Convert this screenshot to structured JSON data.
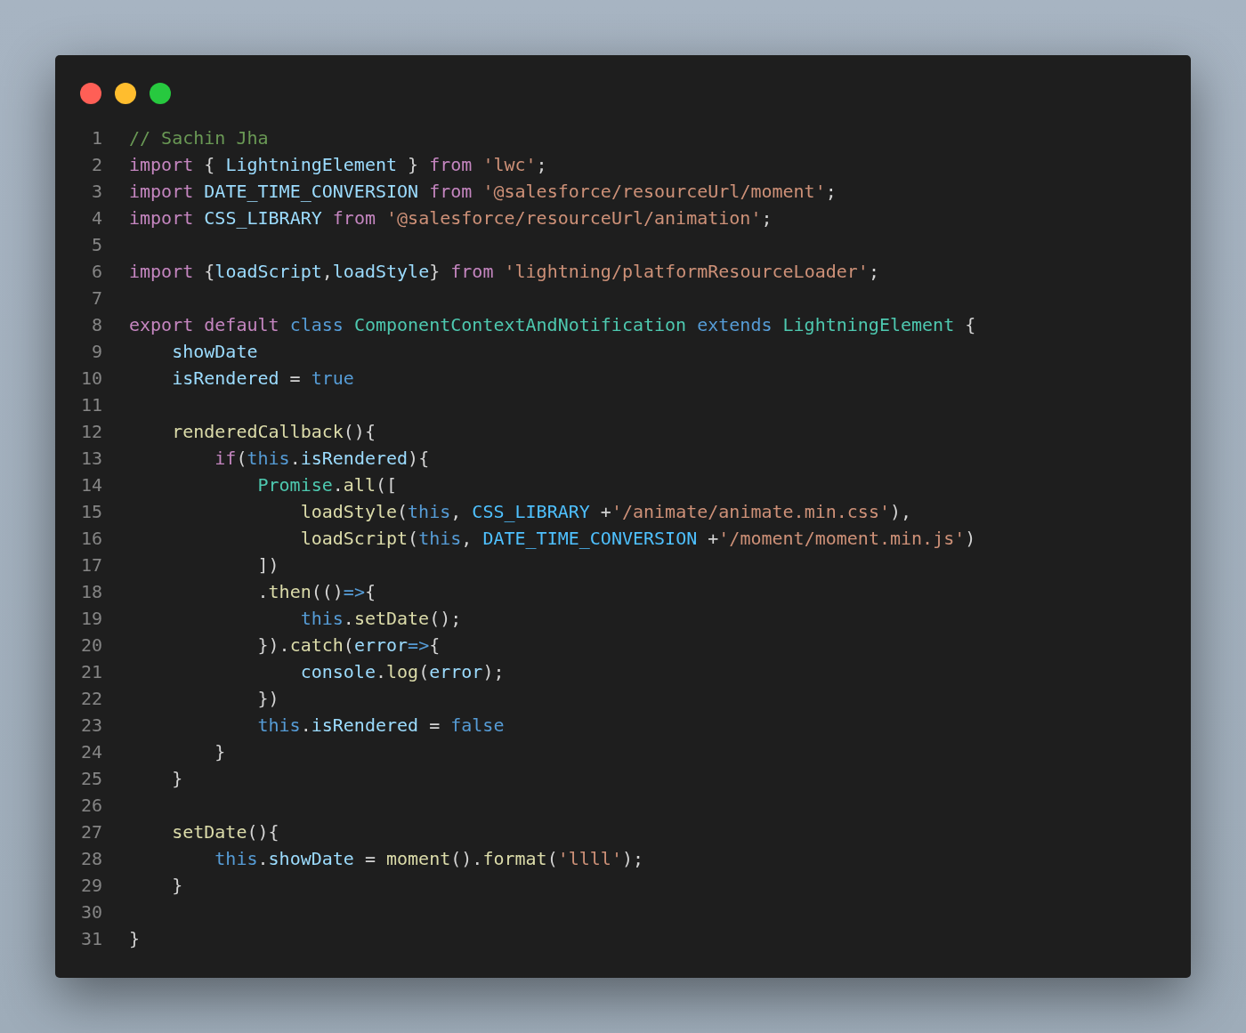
{
  "lines": [
    {
      "number": "1",
      "tokens": [
        {
          "kind": "comment",
          "text": "// Sachin Jha"
        }
      ]
    },
    {
      "number": "2",
      "tokens": [
        {
          "kind": "keyword",
          "text": "import"
        },
        {
          "kind": "plain",
          "text": " { "
        },
        {
          "kind": "variable",
          "text": "LightningElement"
        },
        {
          "kind": "plain",
          "text": " } "
        },
        {
          "kind": "keyword",
          "text": "from "
        },
        {
          "kind": "string",
          "text": "'lwc'"
        },
        {
          "kind": "plain",
          "text": ";"
        }
      ]
    },
    {
      "number": "3",
      "tokens": [
        {
          "kind": "keyword",
          "text": "import "
        },
        {
          "kind": "variable",
          "text": "DATE_TIME_CONVERSION "
        },
        {
          "kind": "keyword",
          "text": "from "
        },
        {
          "kind": "string",
          "text": "'@salesforce/resourceUrl/moment'"
        },
        {
          "kind": "plain",
          "text": ";"
        }
      ]
    },
    {
      "number": "4",
      "tokens": [
        {
          "kind": "keyword",
          "text": "import "
        },
        {
          "kind": "variable",
          "text": "CSS_LIBRARY "
        },
        {
          "kind": "keyword",
          "text": "from "
        },
        {
          "kind": "string",
          "text": "'@salesforce/resourceUrl/animation'"
        },
        {
          "kind": "plain",
          "text": ";"
        }
      ]
    },
    {
      "number": "5"
    },
    {
      "number": "6",
      "tokens": [
        {
          "kind": "keyword",
          "text": "import"
        },
        {
          "kind": "plain",
          "text": " {"
        },
        {
          "kind": "variable",
          "text": "loadScript"
        },
        {
          "kind": "plain",
          "text": ","
        },
        {
          "kind": "variable",
          "text": "loadStyle"
        },
        {
          "kind": "plain",
          "text": "} "
        },
        {
          "kind": "keyword",
          "text": "from "
        },
        {
          "kind": "string",
          "text": "'lightning/platformResourceLoader'"
        },
        {
          "kind": "plain",
          "text": ";"
        }
      ]
    },
    {
      "number": "7"
    },
    {
      "number": "8",
      "tokens": [
        {
          "kind": "keyword",
          "text": "export default "
        },
        {
          "kind": "storage",
          "text": "class "
        },
        {
          "kind": "class",
          "text": "ComponentContextAndNotification "
        },
        {
          "kind": "storage",
          "text": "extends "
        },
        {
          "kind": "class",
          "text": "LightningElement"
        },
        {
          "kind": "plain",
          "text": " {"
        }
      ]
    },
    {
      "number": "9",
      "tokens": [
        {
          "kind": "variable",
          "text": "    showDate"
        }
      ]
    },
    {
      "number": "10",
      "tokens": [
        {
          "kind": "variable",
          "text": "    isRendered"
        },
        {
          "kind": "plain",
          "text": " = "
        },
        {
          "kind": "storage",
          "text": "true"
        }
      ]
    },
    {
      "number": "11"
    },
    {
      "number": "12",
      "tokens": [
        {
          "kind": "function",
          "text": "    renderedCallback"
        },
        {
          "kind": "plain",
          "text": "(){"
        }
      ]
    },
    {
      "number": "13",
      "tokens": [
        {
          "kind": "keyword",
          "text": "        if"
        },
        {
          "kind": "plain",
          "text": "("
        },
        {
          "kind": "storage",
          "text": "this"
        },
        {
          "kind": "plain",
          "text": "."
        },
        {
          "kind": "variable",
          "text": "isRendered"
        },
        {
          "kind": "plain",
          "text": "){"
        }
      ]
    },
    {
      "number": "14",
      "tokens": [
        {
          "kind": "class",
          "text": "            Promise"
        },
        {
          "kind": "plain",
          "text": "."
        },
        {
          "kind": "function",
          "text": "all"
        },
        {
          "kind": "plain",
          "text": "(["
        }
      ]
    },
    {
      "number": "15",
      "tokens": [
        {
          "kind": "function",
          "text": "                loadStyle"
        },
        {
          "kind": "plain",
          "text": "("
        },
        {
          "kind": "storage",
          "text": "this"
        },
        {
          "kind": "plain",
          "text": ", "
        },
        {
          "kind": "constant",
          "text": "CSS_LIBRARY"
        },
        {
          "kind": "plain",
          "text": " +"
        },
        {
          "kind": "string",
          "text": "'/animate/animate.min.css'"
        },
        {
          "kind": "plain",
          "text": "),"
        }
      ]
    },
    {
      "number": "16",
      "tokens": [
        {
          "kind": "function",
          "text": "                loadScript"
        },
        {
          "kind": "plain",
          "text": "("
        },
        {
          "kind": "storage",
          "text": "this"
        },
        {
          "kind": "plain",
          "text": ", "
        },
        {
          "kind": "constant",
          "text": "DATE_TIME_CONVERSION"
        },
        {
          "kind": "plain",
          "text": " +"
        },
        {
          "kind": "string",
          "text": "'/moment/moment.min.js'"
        },
        {
          "kind": "plain",
          "text": ")"
        }
      ]
    },
    {
      "number": "17",
      "tokens": [
        {
          "kind": "plain",
          "text": "            ])"
        }
      ]
    },
    {
      "number": "18",
      "tokens": [
        {
          "kind": "plain",
          "text": "            ."
        },
        {
          "kind": "function",
          "text": "then"
        },
        {
          "kind": "plain",
          "text": "(()"
        },
        {
          "kind": "storage",
          "text": "=>"
        },
        {
          "kind": "plain",
          "text": "{"
        }
      ]
    },
    {
      "number": "19",
      "tokens": [
        {
          "kind": "storage",
          "text": "                this"
        },
        {
          "kind": "plain",
          "text": "."
        },
        {
          "kind": "function",
          "text": "setDate"
        },
        {
          "kind": "plain",
          "text": "();"
        }
      ]
    },
    {
      "number": "20",
      "tokens": [
        {
          "kind": "plain",
          "text": "            })."
        },
        {
          "kind": "function",
          "text": "catch"
        },
        {
          "kind": "plain",
          "text": "("
        },
        {
          "kind": "variable",
          "text": "error"
        },
        {
          "kind": "storage",
          "text": "=>"
        },
        {
          "kind": "plain",
          "text": "{"
        }
      ]
    },
    {
      "number": "21",
      "tokens": [
        {
          "kind": "variable",
          "text": "                console"
        },
        {
          "kind": "plain",
          "text": "."
        },
        {
          "kind": "function",
          "text": "log"
        },
        {
          "kind": "plain",
          "text": "("
        },
        {
          "kind": "variable",
          "text": "error"
        },
        {
          "kind": "plain",
          "text": ");"
        }
      ]
    },
    {
      "number": "22",
      "tokens": [
        {
          "kind": "plain",
          "text": "            })"
        }
      ]
    },
    {
      "number": "23",
      "tokens": [
        {
          "kind": "storage",
          "text": "            this"
        },
        {
          "kind": "plain",
          "text": "."
        },
        {
          "kind": "variable",
          "text": "isRendered"
        },
        {
          "kind": "plain",
          "text": " = "
        },
        {
          "kind": "storage",
          "text": "false"
        }
      ]
    },
    {
      "number": "24",
      "tokens": [
        {
          "kind": "plain",
          "text": "        }"
        }
      ]
    },
    {
      "number": "25",
      "tokens": [
        {
          "kind": "plain",
          "text": "    }"
        }
      ]
    },
    {
      "number": "26"
    },
    {
      "number": "27",
      "tokens": [
        {
          "kind": "function",
          "text": "    setDate"
        },
        {
          "kind": "plain",
          "text": "(){"
        }
      ]
    },
    {
      "number": "28",
      "tokens": [
        {
          "kind": "storage",
          "text": "        this"
        },
        {
          "kind": "plain",
          "text": "."
        },
        {
          "kind": "variable",
          "text": "showDate"
        },
        {
          "kind": "plain",
          "text": " = "
        },
        {
          "kind": "function",
          "text": "moment"
        },
        {
          "kind": "plain",
          "text": "()."
        },
        {
          "kind": "function",
          "text": "format"
        },
        {
          "kind": "plain",
          "text": "("
        },
        {
          "kind": "string",
          "text": "'llll'"
        },
        {
          "kind": "plain",
          "text": ");"
        }
      ]
    },
    {
      "number": "29",
      "tokens": [
        {
          "kind": "plain",
          "text": "    }"
        }
      ]
    },
    {
      "number": "30"
    },
    {
      "number": "31",
      "tokens": [
        {
          "kind": "plain",
          "text": "}"
        }
      ]
    }
  ]
}
